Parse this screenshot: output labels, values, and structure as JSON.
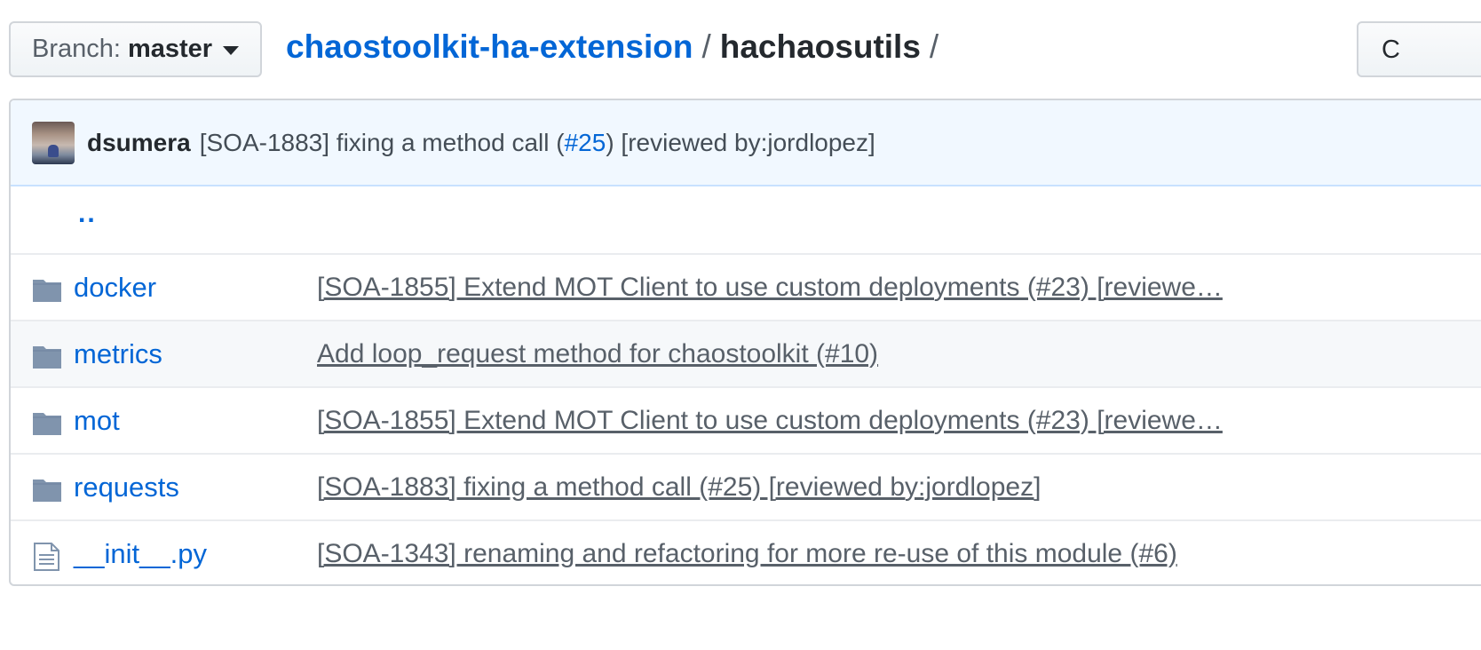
{
  "branch": {
    "label": "Branch:",
    "name": "master"
  },
  "breadcrumb": {
    "repo": "chaostoolkit-ha-extension",
    "sep1": "/",
    "folder": "hachaosutils",
    "sep2": "/"
  },
  "right_button": {
    "label": "C"
  },
  "latest_commit": {
    "author": "dsumera",
    "message_before": "[SOA-1883] fixing a method call (",
    "pr": "#25",
    "message_after": ") [reviewed by:jordlopez]"
  },
  "parent_link": "..",
  "files": [
    {
      "name": "docker",
      "type": "folder-icon",
      "message": "[SOA-1855] Extend MOT Client to use custom deployments (#23) [reviewe…"
    },
    {
      "name": "metrics",
      "type": "folder-icon",
      "message": "Add loop_request method for chaostoolkit (#10)"
    },
    {
      "name": "mot",
      "type": "folder-icon",
      "message": "[SOA-1855] Extend MOT Client to use custom deployments (#23) [reviewe…"
    },
    {
      "name": "requests",
      "type": "folder-icon",
      "message": "[SOA-1883] fixing a method call (#25) [reviewed by:jordlopez]"
    },
    {
      "name": "__init__.py",
      "type": "file-icon",
      "message": "[SOA-1343] renaming and refactoring for more re-use of this module (#6)"
    }
  ],
  "colors": {
    "link": "#0366d6",
    "folder_icon": "#8094ad",
    "commit_bar_bg": "#f1f8ff",
    "row_alt_bg": "#f6f8fa"
  }
}
